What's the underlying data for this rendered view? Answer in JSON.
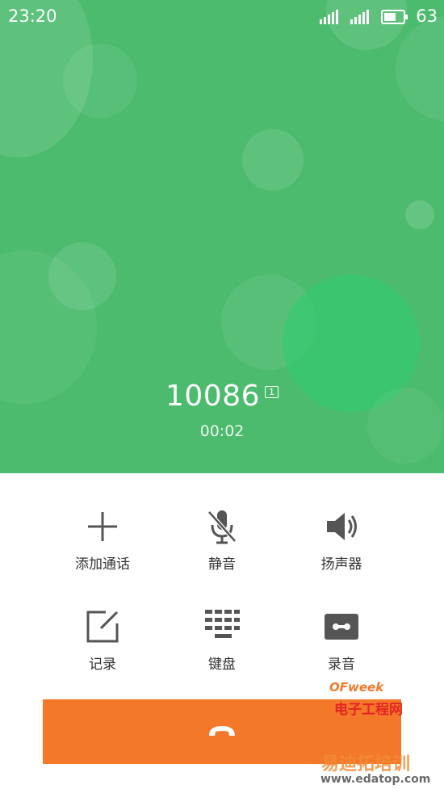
{
  "status_bar": {
    "time": "23:20",
    "battery_level": "63",
    "signal_icon": "signal-icon",
    "battery_icon": "battery-icon"
  },
  "call": {
    "number": "10086",
    "sim_badge": "1",
    "duration": "00:02"
  },
  "controls": [
    {
      "label": "添加通话",
      "icon": "add-call-icon"
    },
    {
      "label": "静音",
      "icon": "mute-mic-icon"
    },
    {
      "label": "扬声器",
      "icon": "speaker-icon"
    },
    {
      "label": "记录",
      "icon": "note-edit-icon"
    },
    {
      "label": "键盘",
      "icon": "dialpad-icon"
    },
    {
      "label": "录音",
      "icon": "recorder-icon"
    }
  ],
  "end_call": {
    "icon": "end-call-icon"
  },
  "watermark": {
    "brand": "OFweek",
    "site_name": "电子工程网",
    "overlay_text": "易迪拓培训",
    "url": "www.edatop.com"
  },
  "colors": {
    "call_background": "#4cbb6e",
    "end_call_button": "#f4782a",
    "icon_gray": "#555555"
  }
}
